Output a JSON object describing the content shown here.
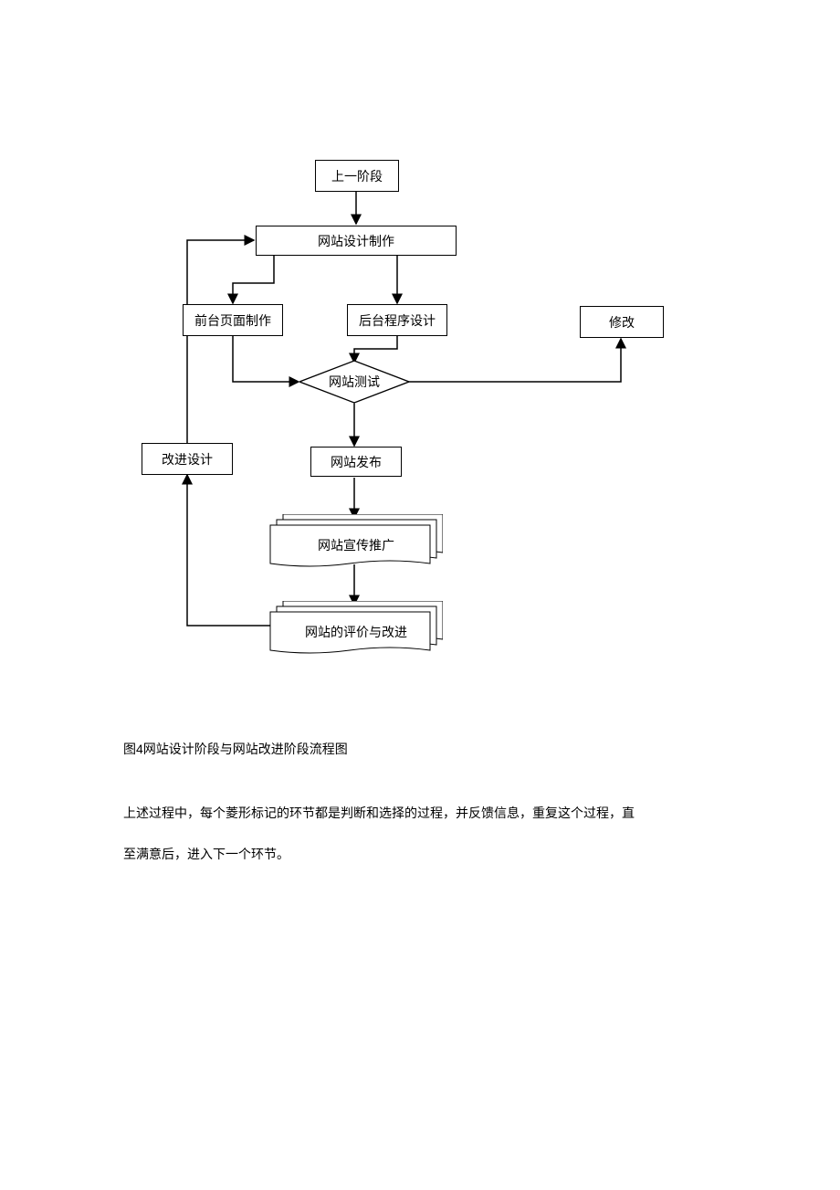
{
  "nodes": {
    "prev_stage": "上一阶段",
    "design_make": "网站设计制作",
    "frontend": "前台页面制作",
    "backend": "后台程序设计",
    "modify": "修改",
    "test": "网站测试",
    "improve_design": "改进设计",
    "publish": "网站发布",
    "promote": "网站宣传推广",
    "evaluate": "网站的评价与改进"
  },
  "caption": "图4网站设计阶段与网站改进阶段流程图",
  "paragraph1": "上述过程中，每个菱形标记的环节都是判断和选择的过程，并反馈信息，重复这个过程，直",
  "paragraph2": "至满意后，进入下一个环节。"
}
